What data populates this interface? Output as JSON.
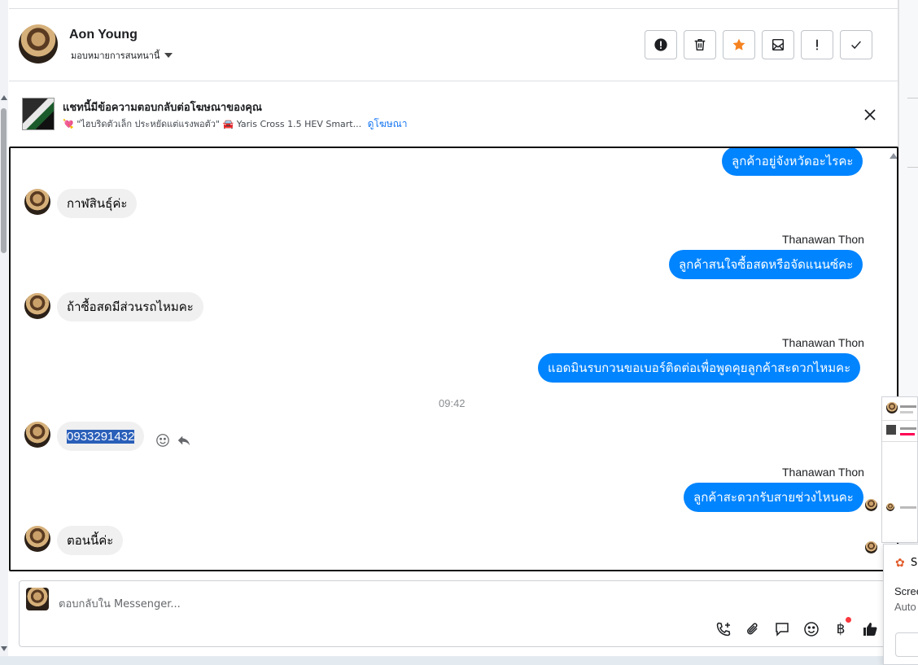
{
  "header": {
    "name": "Aon Young",
    "assign_label": "มอบหมายการสนทนานี้"
  },
  "ad": {
    "title": "แชทนี้มีข้อความตอบกลับต่อโฆษณาของคุณ",
    "subtitle_heart": "💘",
    "subtitle_quote": "\"ไฮบริดตัวเล็ก ประหยัดแต่แรงพอตัว\"",
    "subtitle_car": "🚘",
    "subtitle_model": "Yaris Cross 1.5 HEV Smart...",
    "link": "ดูโฆษณา"
  },
  "messages": [
    {
      "type": "out",
      "text": "ลูกค้าอยู่จังหวัดอะไรคะ"
    },
    {
      "type": "in",
      "text": "กาฬสินธุ์ค่ะ"
    },
    {
      "type": "sender",
      "text": "Thanawan Thon"
    },
    {
      "type": "out",
      "text": "ลูกค้าสนใจซื้อสดหรือจัดแนนซ์คะ"
    },
    {
      "type": "in",
      "text": "ถ้าซื้อสดมีส่วนรถไหมคะ"
    },
    {
      "type": "sender",
      "text": "Thanawan Thon"
    },
    {
      "type": "out",
      "text": "แอดมินรบกวนขอเบอร์ติดต่อเพื่อพูดคุยลูกค้าสะดวกไหมคะ"
    },
    {
      "type": "time",
      "text": "09:42"
    },
    {
      "type": "in",
      "text": "0933291432"
    },
    {
      "type": "sender",
      "text": "Thanawan Thon"
    },
    {
      "type": "out",
      "text": "ลูกค้าสะดวกรับสายช่วงไหนคะ"
    },
    {
      "type": "in",
      "text": "ตอนนี้ค่ะ"
    }
  ],
  "composer": {
    "placeholder": "ตอบกลับใน Messenger...",
    "currency_symbol": "฿"
  },
  "side_notification": {
    "icon_letter": "S",
    "line1": "Scree",
    "line2": "Auto"
  },
  "colors": {
    "outgoing_bubble": "#0084ff",
    "incoming_bubble": "#f0f0f0",
    "link": "#1877f2",
    "star": "#f5821f",
    "selection": "#2a5fb9"
  },
  "icons": {
    "header_actions": [
      "alert-circle-icon",
      "trash-icon",
      "star-icon",
      "spam-icon",
      "exclamation-icon",
      "check-icon"
    ],
    "composer_tools": [
      "call-add-icon",
      "attachment-icon",
      "saved-replies-icon",
      "emoji-icon",
      "payment-icon",
      "thumbs-up-icon"
    ]
  }
}
